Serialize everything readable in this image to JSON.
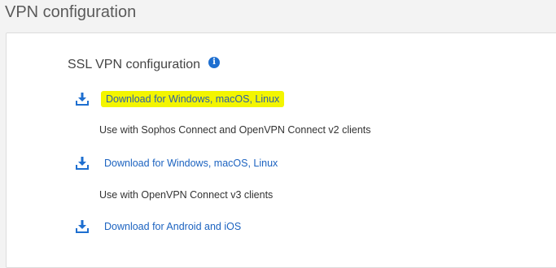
{
  "page": {
    "title": "VPN configuration"
  },
  "section": {
    "title": "SSL VPN configuration",
    "info_icon": "info-icon"
  },
  "downloads": [
    {
      "label": "Download for Windows, macOS, Linux",
      "description": "Use with Sophos Connect and OpenVPN Connect v2 clients",
      "icon": "download-icon",
      "highlighted": true
    },
    {
      "label": "Download for Windows, macOS, Linux",
      "description": "Use with OpenVPN Connect v3 clients",
      "icon": "download-icon",
      "highlighted": false
    },
    {
      "label": "Download for Android and iOS",
      "description": "",
      "icon": "download-icon",
      "highlighted": false
    }
  ],
  "colors": {
    "link": "#1c63c0",
    "highlight": "#f3f500",
    "icon": "#1e6fd0"
  }
}
